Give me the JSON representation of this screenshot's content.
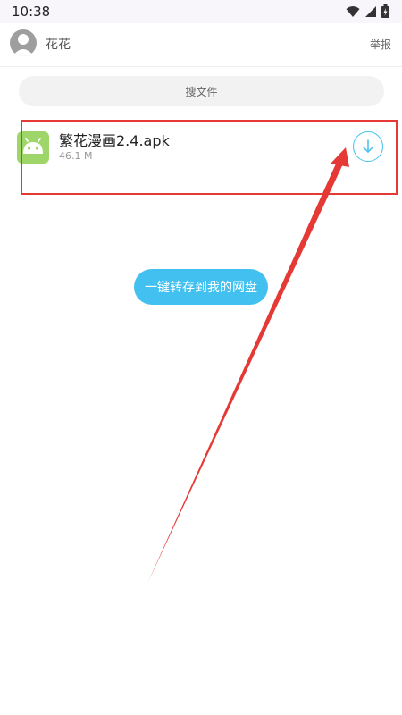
{
  "status_bar": {
    "time": "10:38",
    "icons": [
      "wifi-icon",
      "signal-icon",
      "battery-icon"
    ]
  },
  "header": {
    "user_name": "花花",
    "report_label": "举报",
    "avatar_icon": "user-avatar-icon"
  },
  "search": {
    "label": "搜文件"
  },
  "file": {
    "name": "繁花漫画2.4.apk",
    "size": "46.1 M",
    "icon": "android-apk-icon",
    "action_icon": "download-icon"
  },
  "actions": {
    "save_label": "一键转存到我的网盘"
  },
  "colors": {
    "accent": "#42c1f0",
    "apk_icon": "#9fd669",
    "annotation_red": "#e53935"
  }
}
